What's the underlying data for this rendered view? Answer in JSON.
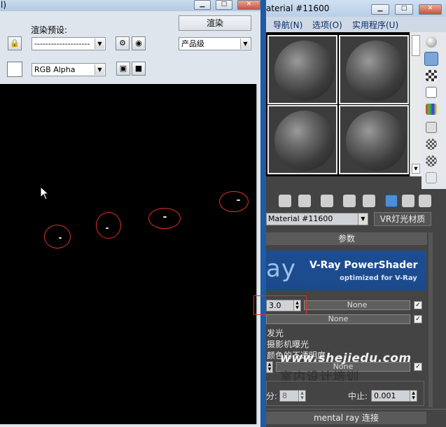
{
  "render_window": {
    "title_fragment": "l)",
    "preset_label": "渲染预设:",
    "preset_value": "--------------------",
    "render_button": "渲染",
    "quality_value": "产品级",
    "channel_value": "RGB Alpha"
  },
  "material_editor": {
    "title_fragment": "aterial #11600",
    "menus": [
      "导航(N)",
      "选项(O)",
      "实用程序(U)"
    ],
    "material_name": "Material #11600",
    "material_type": "VR灯光材质",
    "rollout_title": "参数",
    "banner": {
      "logo": "ay",
      "title": "V-Ray PowerShader",
      "subtitle": "optimized for V-Ray"
    },
    "color_multiplier": "3.0",
    "map_button_1": "None",
    "map_button_2": "None",
    "map_button_3": "None",
    "line_1": "发光",
    "line_2": "摄影机曝光",
    "line_3": "颜色的不透明度",
    "subdiv_label": "分:",
    "subdiv_value": "8",
    "cutoff_label": "中止:",
    "cutoff_value": "0.001",
    "mental_ray": "mental ray 连接"
  },
  "watermark": {
    "url": "www.shejiedu.com",
    "text": "室内设计培训"
  },
  "colors": {
    "highlight": "#e0302a",
    "banner": "#1d4d91",
    "divider": "#1f5aa5"
  }
}
